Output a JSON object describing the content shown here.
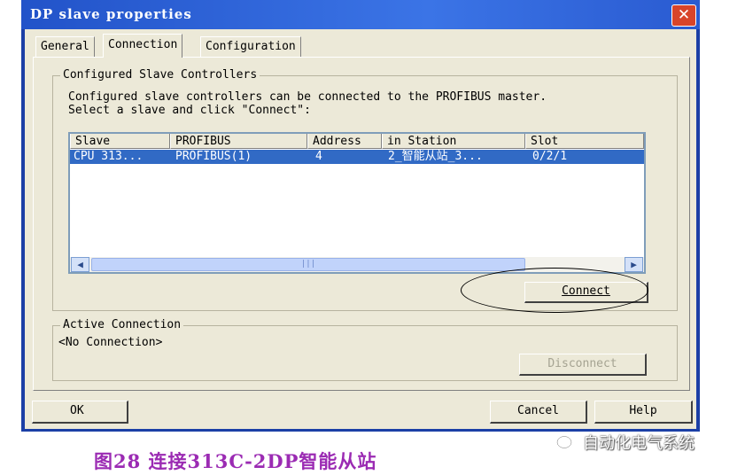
{
  "window": {
    "title": "DP slave properties",
    "close_label": "✕"
  },
  "tabs": [
    {
      "label": "General",
      "active": false
    },
    {
      "label": "Connection",
      "active": true
    },
    {
      "label": "Configuration",
      "active": false
    }
  ],
  "configured": {
    "legend": "Configured Slave Controllers",
    "line1": "Configured slave controllers can be connected to the PROFIBUS master.",
    "line2": "Select a slave and click \"Connect\":",
    "columns": [
      "Slave",
      "PROFIBUS",
      "Address",
      "in Station",
      "Slot"
    ],
    "rows": [
      {
        "slave": "CPU 313...",
        "profibus": "PROFIBUS(1)",
        "address": "4",
        "station": "2_智能从站_3...",
        "slot": "0/2/1"
      }
    ],
    "scroll_left_icon": "scroll-left-arrow",
    "scroll_right_icon": "scroll-right-arrow",
    "connect_label": "Connect"
  },
  "active_connection": {
    "legend": "Active Connection",
    "status": "<No Connection>",
    "disconnect_label": "Disconnect"
  },
  "footer": {
    "ok_label": "OK",
    "cancel_label": "Cancel",
    "help_label": "Help"
  },
  "caption": "图28  连接313C-2DP智能从站",
  "watermark": "自动化电气系统",
  "colors": {
    "title_bar": "#3b74e6",
    "selection": "#316ac5",
    "caption": "#9b2bb3"
  }
}
